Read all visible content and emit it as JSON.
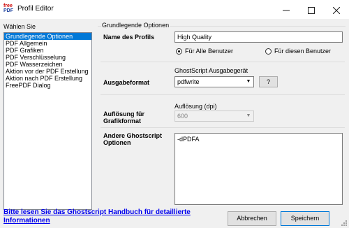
{
  "window": {
    "title": "Profil Editor",
    "logo_top": "free",
    "logo_bottom": "PDF"
  },
  "left": {
    "title": "Wählen Sie",
    "items": [
      "Grundlegende Optionen",
      "PDF Allgemein",
      "PDF Grafiken",
      "PDF Verschlüsselung",
      "PDF Wasserzeichen",
      "Aktion vor der PDF Erstellung",
      "Aktion nach PDF Erstellung",
      "FreePDF Dialog"
    ],
    "selected_index": 0
  },
  "group": {
    "title": "Grundlegende Optionen"
  },
  "profile": {
    "label": "Name des Profils",
    "value": "High Quality",
    "radio_all": "Für Alle Benutzer",
    "radio_this": "Für diesen Benutzer",
    "radio_selected": "all"
  },
  "output": {
    "label": "Ausgabeformat",
    "device_label": "GhostScript Ausgabegerät",
    "device_value": "pdfwrite",
    "help_button": "?"
  },
  "resolution": {
    "label_line1": "Auflösung für",
    "label_line2": "Grafikformat",
    "dpi_label": "Auflösung (dpi)",
    "dpi_value": "600"
  },
  "ghostscript": {
    "label_line1": "Andere Ghostscript",
    "label_line2": "Optionen",
    "value": "-dPDFA"
  },
  "footer": {
    "help_link_line1": "Bitte lesen Sie das Ghostscript Handbuch für detaillierte",
    "help_link_line2": "Informationen",
    "cancel": "Abbrechen",
    "save": "Speichern"
  },
  "colors": {
    "selection": "#0078d7",
    "link": "#0000ee"
  }
}
